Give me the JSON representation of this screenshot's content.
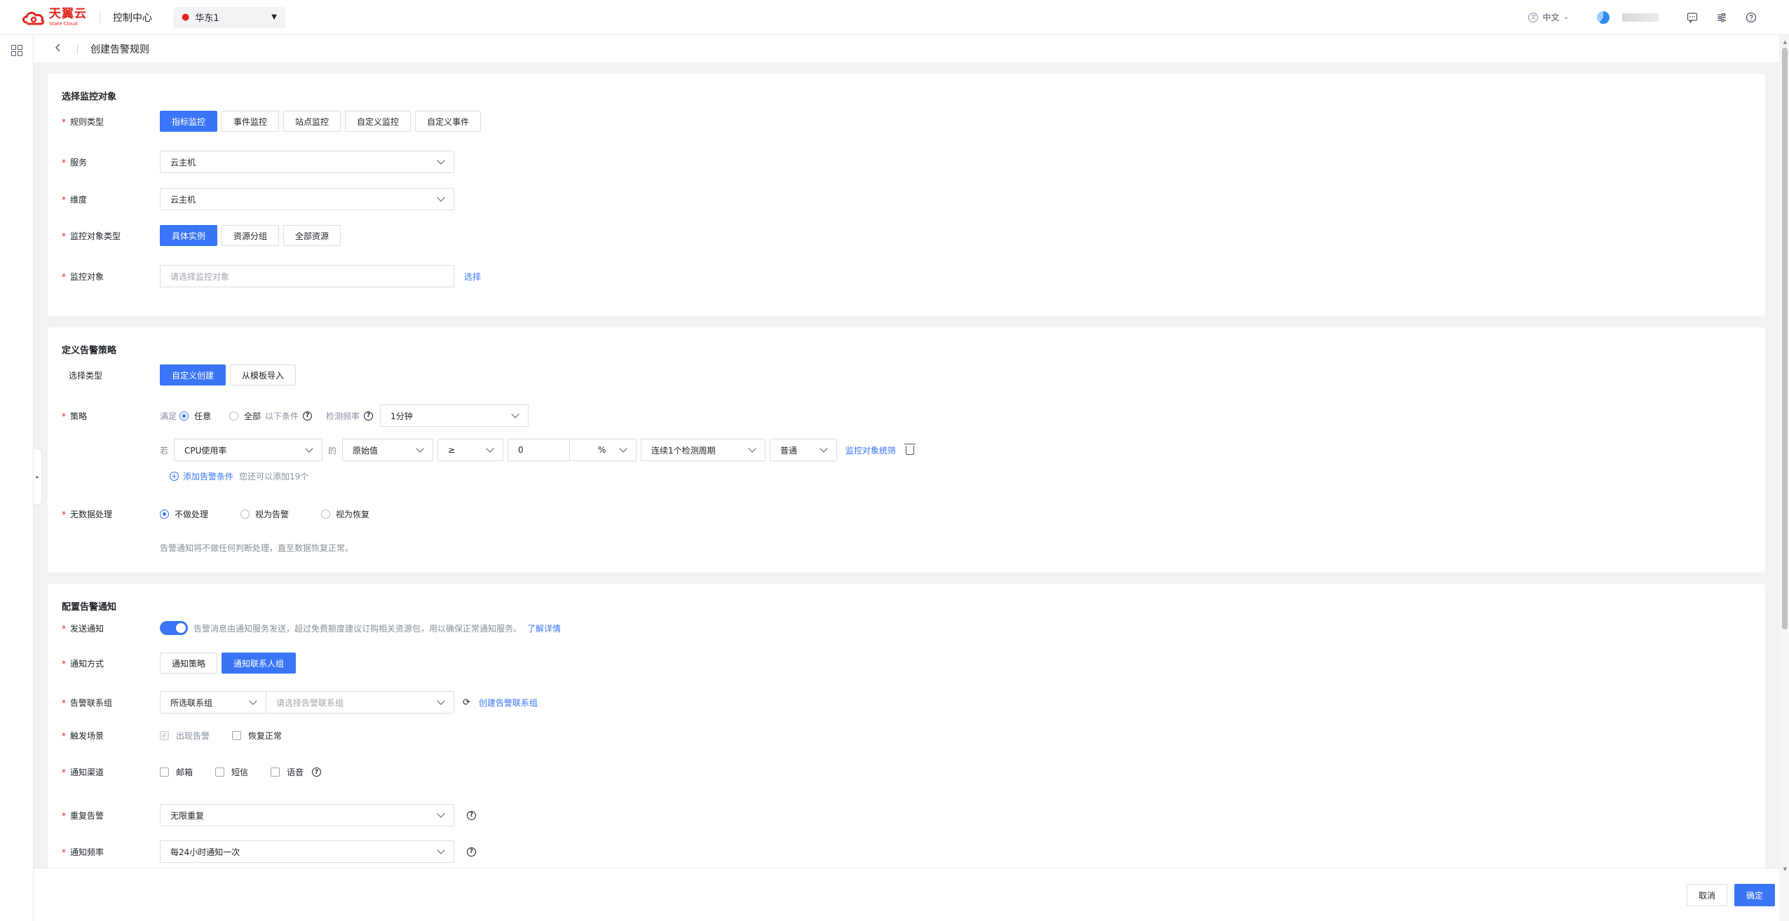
{
  "topbar": {
    "logo_cn": "天翼云",
    "logo_en": "State Cloud",
    "console_label": "控制中心",
    "region": "华东1",
    "language": "中文"
  },
  "page": {
    "title": "创建告警规则"
  },
  "section1": {
    "title": "选择监控对象",
    "rule_type_label": "规则类型",
    "rule_types": [
      "指标监控",
      "事件监控",
      "站点监控",
      "自定义监控",
      "自定义事件"
    ],
    "service_label": "服务",
    "service_value": "云主机",
    "dimension_label": "维度",
    "dimension_value": "云主机",
    "object_type_label": "监控对象类型",
    "object_types": [
      "具体实例",
      "资源分组",
      "全部资源"
    ],
    "object_label": "监控对象",
    "object_placeholder": "请选择监控对象",
    "select_link": "选择"
  },
  "section2": {
    "title": "定义告警策略",
    "select_type_label": "选择类型",
    "select_types": [
      "自定义创建",
      "从模板导入"
    ],
    "policy_label": "策略",
    "satisfy_label": "满足",
    "any_label": "任意",
    "all_label": "全部",
    "following_conditions": "以下条件",
    "detect_freq_label": "检测频率",
    "detect_freq_value": "1分钟",
    "if_label": "若",
    "metric_value": "CPU使用率",
    "of_label": "的",
    "stat_value": "原始值",
    "operator_value": "≥",
    "threshold_value": "0",
    "unit_value": "%",
    "period_value": "连续1个检测周期",
    "level_value": "普通",
    "object_filter_link": "监控对象统筛",
    "add_condition_link": "添加告警条件",
    "add_condition_hint": "您还可以添加19个",
    "no_data_label": "无数据处理",
    "no_data_options": [
      "不做处理",
      "视为告警",
      "视为恢复"
    ],
    "no_data_hint": "告警通知将不做任何判断处理，直至数据恢复正常。"
  },
  "section3": {
    "title": "配置告警通知",
    "send_label": "发送通知",
    "send_hint": "告警消息由通知服务发送，超过免费额度建议订购相关资源包，用以确保正常通知服务。",
    "learn_more": "了解详情",
    "method_label": "通知方式",
    "methods": [
      "通知策略",
      "通知联系人组"
    ],
    "contact_group_label": "告警联系组",
    "contact_group_select": "所选联系组",
    "contact_group_placeholder": "请选择告警联系组",
    "create_group_link": "创建告警联系组",
    "trigger_label": "触发场景",
    "trigger_options": [
      "出现告警",
      "恢复正常"
    ],
    "channel_label": "通知渠道",
    "channels": [
      "邮箱",
      "短信",
      "语音"
    ],
    "repeat_label": "重复告警",
    "repeat_value": "无限重复",
    "freq_label": "通知频率",
    "freq_value": "每24小时通知一次"
  },
  "footer": {
    "cancel": "取消",
    "confirm": "确定"
  },
  "colors": {
    "primary": "#3975f6",
    "brand": "#e3261f"
  }
}
